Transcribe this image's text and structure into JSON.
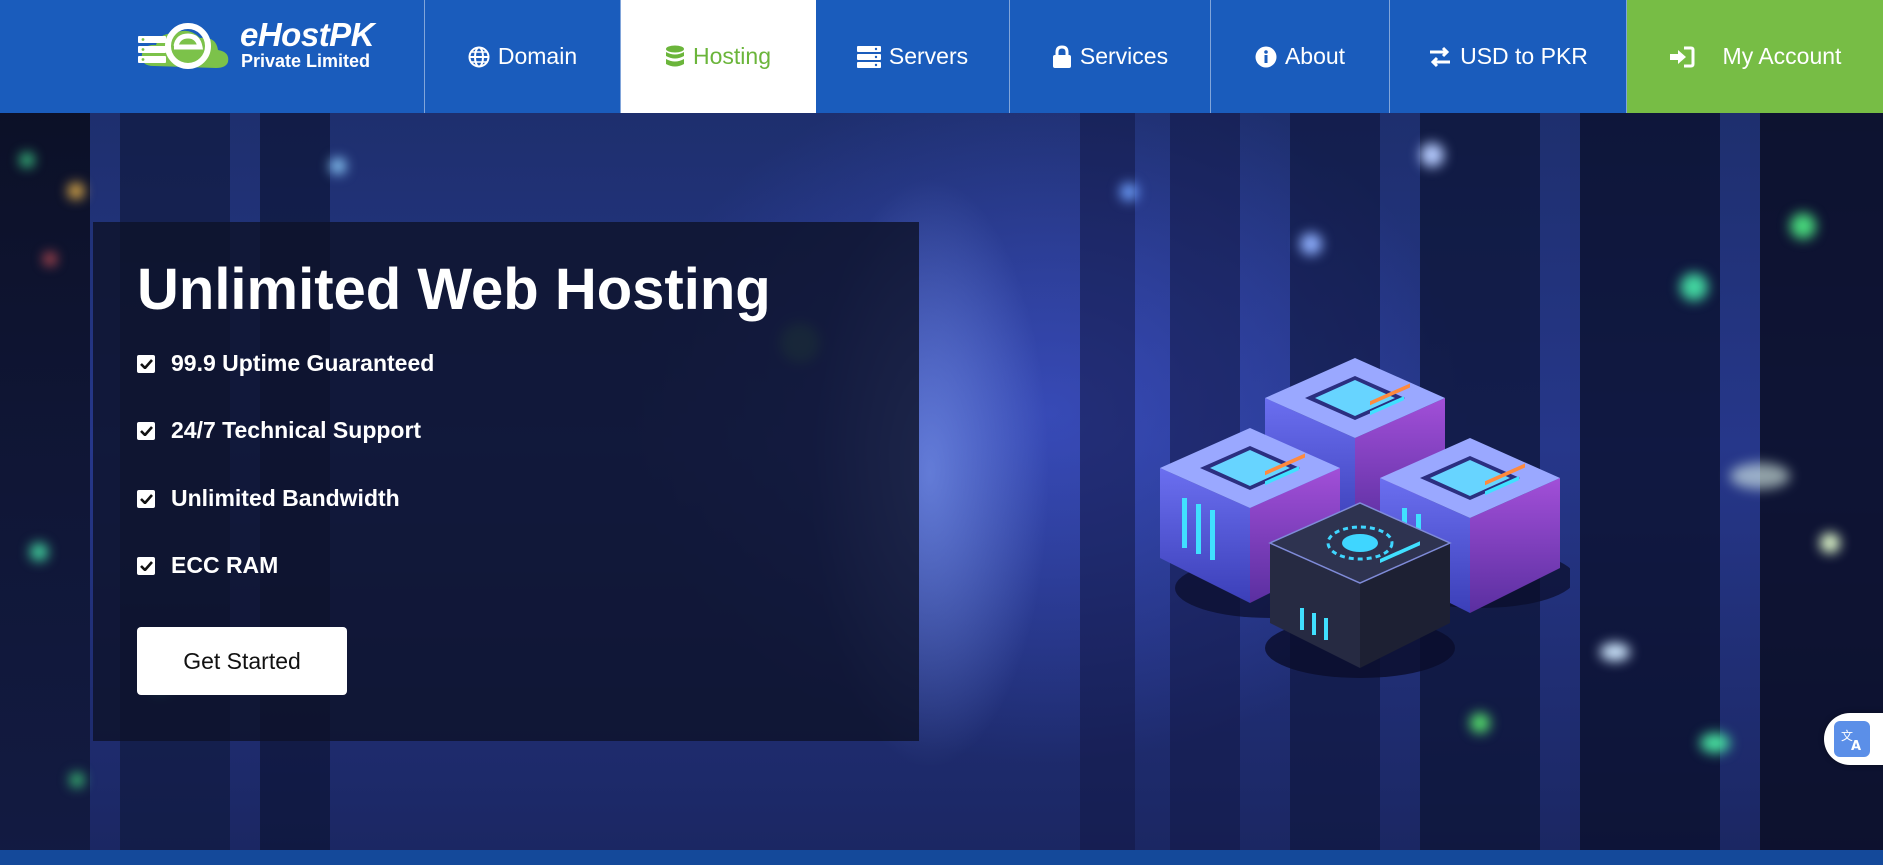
{
  "brand": {
    "name": "eHostPK",
    "subtitle": "Private Limited",
    "logo_icon": "cloud-server-e-logo"
  },
  "nav": {
    "items": [
      {
        "label": "Domain",
        "icon": "globe-icon"
      },
      {
        "label": "Hosting",
        "icon": "database-icon",
        "active": true
      },
      {
        "label": "Servers",
        "icon": "server-icon"
      },
      {
        "label": "Services",
        "icon": "lock-icon"
      },
      {
        "label": "About",
        "icon": "info-icon"
      },
      {
        "label": "USD to PKR",
        "icon": "exchange-icon"
      }
    ],
    "account": {
      "label": "My Account",
      "icon": "sign-in-icon"
    }
  },
  "hero": {
    "title": "Unlimited Web Hosting",
    "features": [
      "99.9 Uptime Guaranteed",
      "24/7 Technical Support",
      "Unlimited Bandwidth",
      "ECC RAM"
    ],
    "cta_label": "Get Started"
  },
  "colors": {
    "nav_blue": "#1a5cbc",
    "accent_green": "#77bd45",
    "active_text": "#6bb53b",
    "panel": "#0e122a"
  },
  "widgets": {
    "translate_icon": "translate-icon"
  }
}
